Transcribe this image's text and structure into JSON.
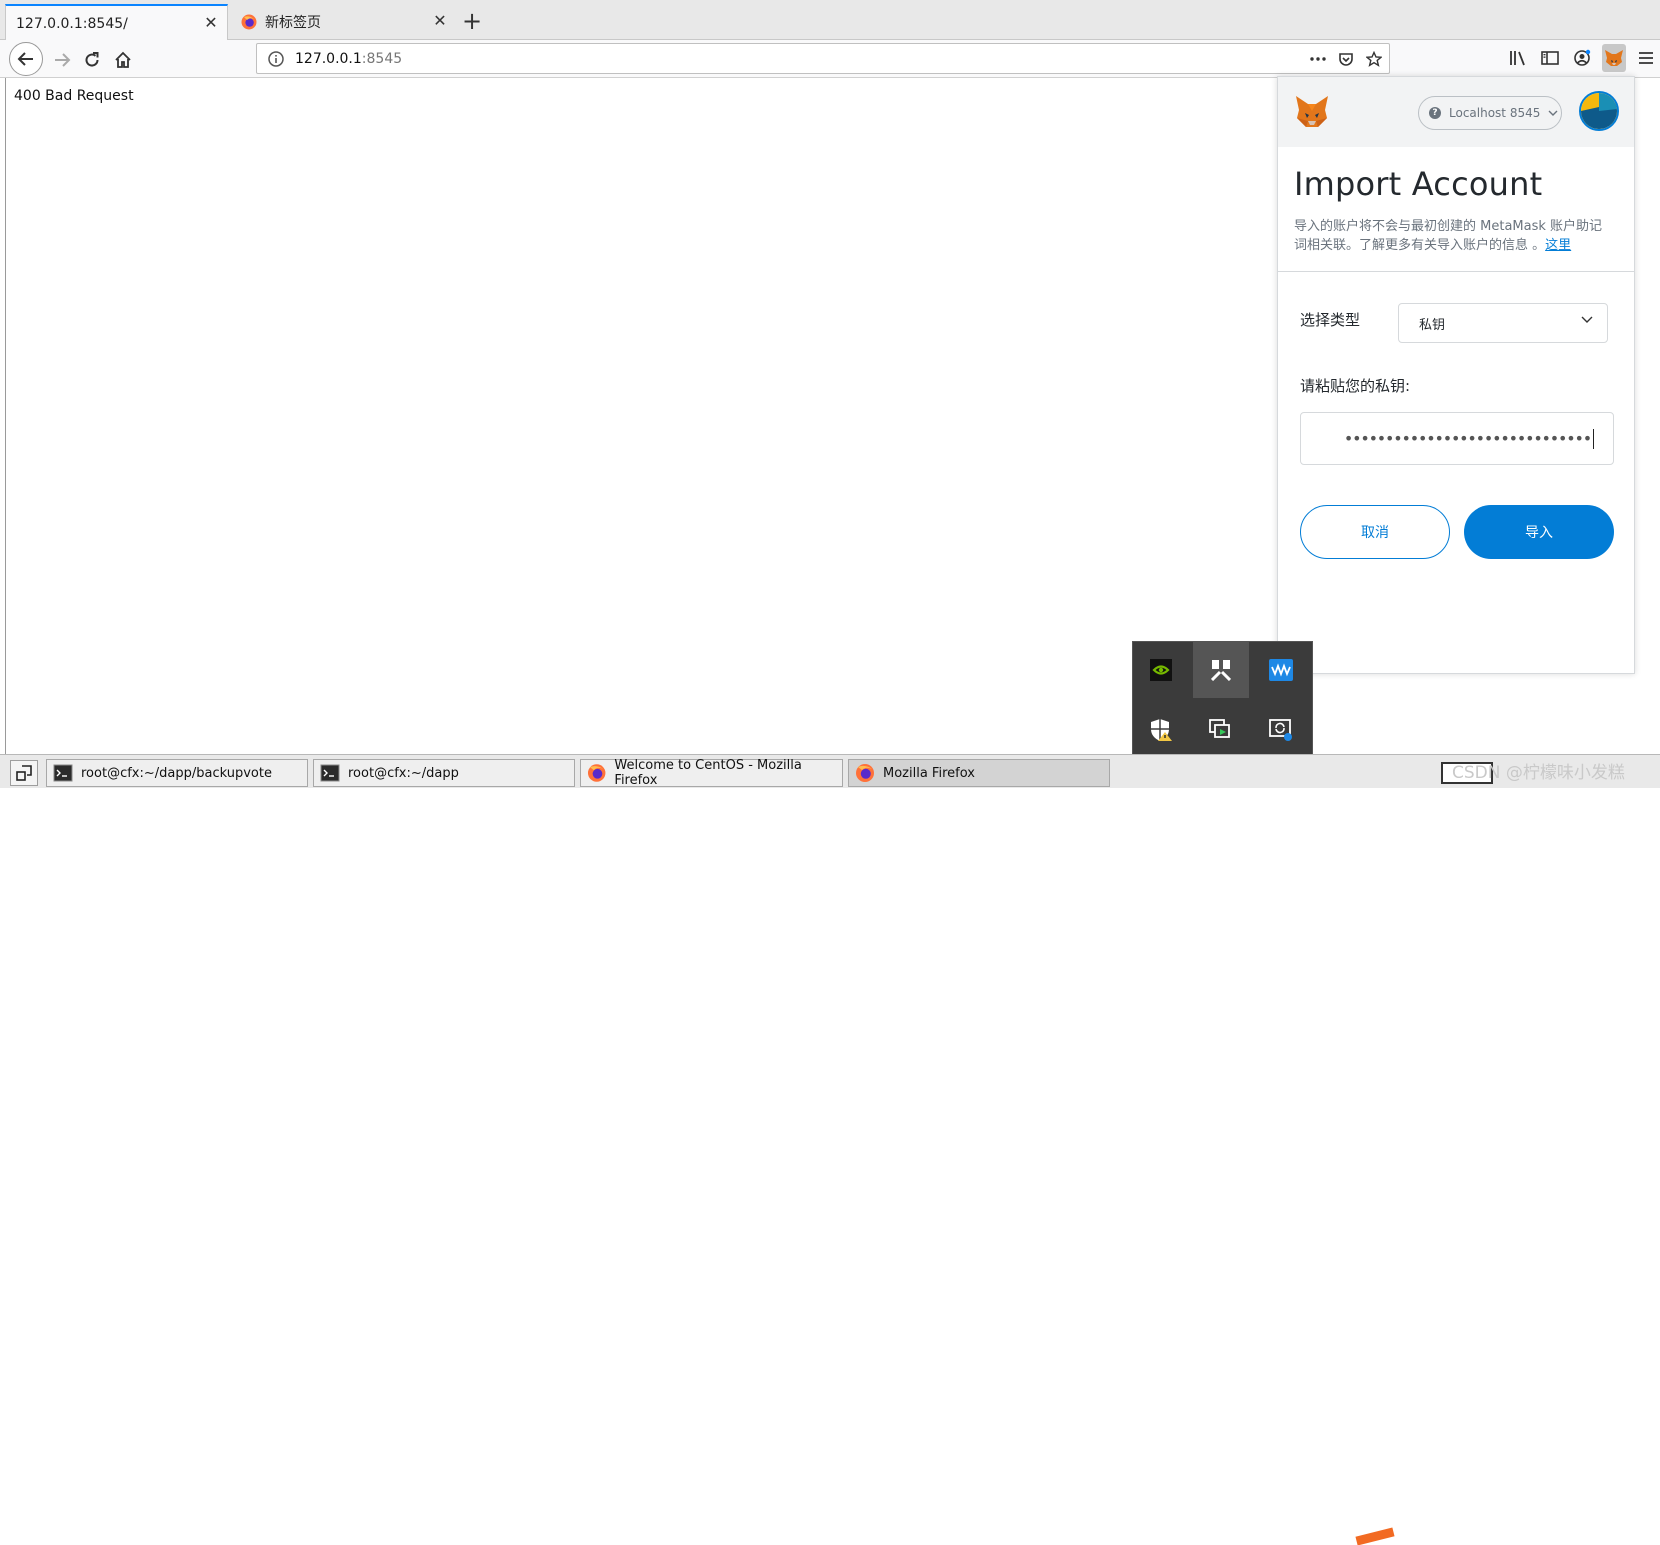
{
  "tabs": [
    {
      "title": "127.0.0.1:8545/",
      "active": true
    },
    {
      "title": "新标签页",
      "active": false
    }
  ],
  "urlbar": {
    "host": "127.0.0.1",
    "port": ":8545"
  },
  "page": {
    "text": "400 Bad Request"
  },
  "metamask": {
    "network": "Localhost 8545",
    "title": "Import Account",
    "description": "导入的账户将不会与最初创建的 MetaMask 账户助记词相关联。了解更多有关导入账户的信息 。",
    "description_link": "这里",
    "type_label": "选择类型",
    "type_value": "私钥",
    "key_label": "请粘贴您的私钥:",
    "key_masked": "••••••••••••••••••••••••••••••",
    "cancel_label": "取消",
    "import_label": "导入",
    "accent_color": "#037dd6"
  },
  "taskbar": {
    "tasks": [
      {
        "label": "root@cfx:~/dapp/backupvote",
        "icon": "terminal-icon"
      },
      {
        "label": "root@cfx:~/dapp",
        "icon": "terminal-icon"
      },
      {
        "label": "Welcome to CentOS - Mozilla Firefox",
        "icon": "firefox-icon"
      },
      {
        "label": "Mozilla Firefox",
        "icon": "firefox-icon"
      }
    ],
    "watermark": "CSDN @柠檬味小发糕"
  },
  "tray_icons": [
    "nvidia-icon",
    "app-grid-icon",
    "audio-wave-icon",
    "security-warning-icon",
    "screen-share-icon",
    "sync-icon"
  ]
}
